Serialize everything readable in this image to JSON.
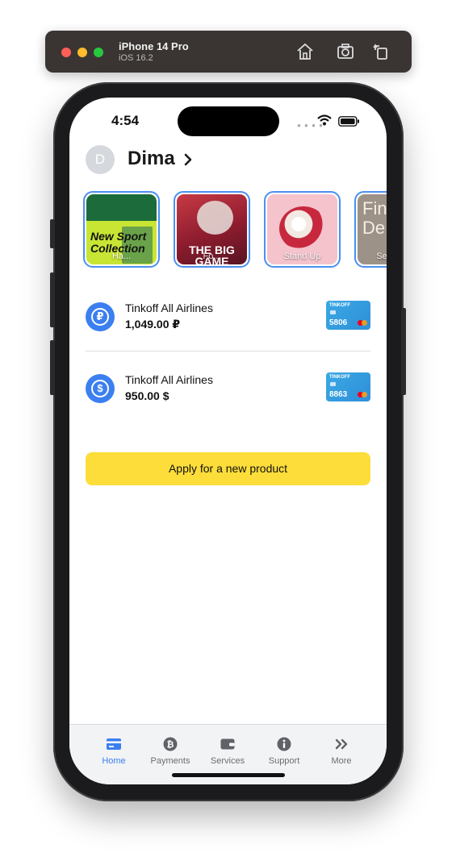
{
  "simulator": {
    "device": "iPhone 14 Pro",
    "os": "iOS 16.2",
    "toolbar_icons": [
      "home-icon",
      "screenshot-icon",
      "rotate-icon"
    ]
  },
  "status_bar": {
    "time": "4:54"
  },
  "header": {
    "avatar_initial": "D",
    "name": "Dima"
  },
  "stories": [
    {
      "label": "Ha...",
      "art_text": "New Sport Collection"
    },
    {
      "label": "Fo...",
      "art_text": "THE BIG GAME"
    },
    {
      "label": "Stand Up",
      "art_text": ""
    },
    {
      "label": "Secon...",
      "art_text": "Fin Per De"
    }
  ],
  "accounts": [
    {
      "name": "Tinkoff All Airlines",
      "balance": "1,049.00 ₽",
      "currency_symbol": "₽",
      "card_brand": "TINKOFF",
      "card_last4": "5806"
    },
    {
      "name": "Tinkoff All Airlines",
      "balance": "950.00 $",
      "currency_symbol": "$",
      "card_brand": "TINKOFF",
      "card_last4": "8863"
    }
  ],
  "apply_button": {
    "label": "Apply for a new product"
  },
  "tabbar": {
    "items": [
      {
        "label": "Home",
        "icon": "card-icon",
        "active": true
      },
      {
        "label": "Payments",
        "icon": "payments-coin-icon",
        "active": false
      },
      {
        "label": "Services",
        "icon": "wallet-icon",
        "active": false
      },
      {
        "label": "Support",
        "icon": "info-icon",
        "active": false
      },
      {
        "label": "More",
        "icon": "double-chevron-icon",
        "active": false
      }
    ]
  },
  "colors": {
    "accent": "#3b7ff0",
    "apply_button": "#fddd39",
    "story_ring": "#4a8ff0",
    "tab_inactive": "#6a6d72"
  }
}
